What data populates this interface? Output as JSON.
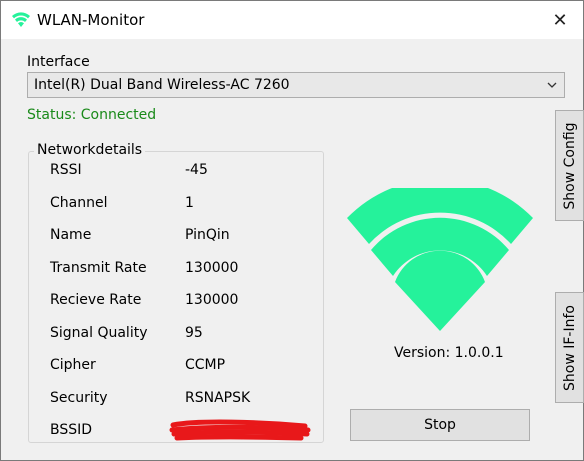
{
  "window": {
    "title": "WLAN-Monitor",
    "close_glyph": "✕"
  },
  "interface": {
    "label": "Interface",
    "selected": "Intel(R) Dual Band Wireless-AC 7260",
    "status": "Status: Connected"
  },
  "details": {
    "title": "Networkdetails",
    "rows": [
      {
        "key": "RSSI",
        "value": "-45"
      },
      {
        "key": "Channel",
        "value": "1"
      },
      {
        "key": "Name",
        "value": "PinQin"
      },
      {
        "key": "Transmit Rate",
        "value": "130000"
      },
      {
        "key": "Recieve Rate",
        "value": "130000"
      },
      {
        "key": "Signal Quality",
        "value": "95"
      },
      {
        "key": "Cipher",
        "value": "CCMP"
      },
      {
        "key": "Security",
        "value": "RSNAPSK"
      },
      {
        "key": "BSSID",
        "value": ""
      }
    ]
  },
  "version": "Version: 1.0.0.1",
  "buttons": {
    "stop": "Stop",
    "show_config": "Show Config",
    "show_if_info": "Show IF-Info"
  },
  "colors": {
    "accent": "#25f29b",
    "status": "#1a8a1a",
    "redaction": "#e8181a"
  },
  "icons": {
    "app": "wifi-icon",
    "signal": "wifi-signal-icon",
    "dropdown": "chevron-down-icon"
  }
}
